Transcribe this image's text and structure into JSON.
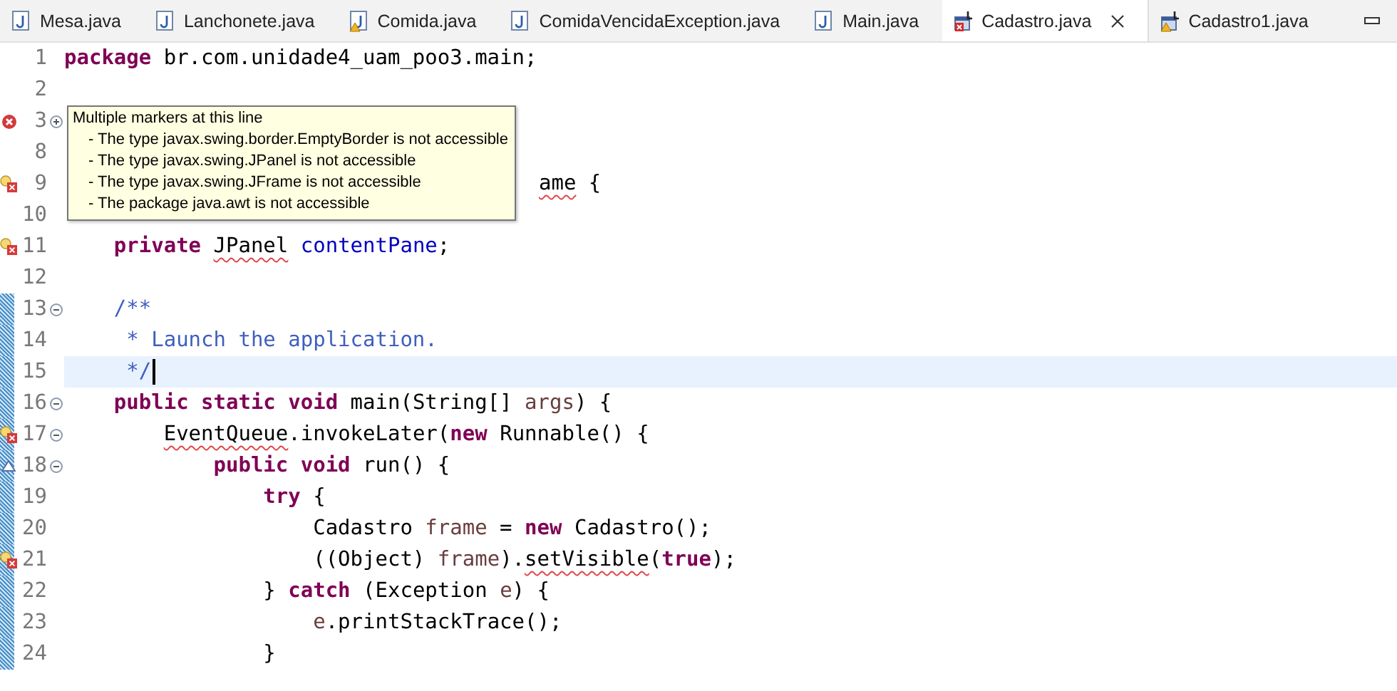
{
  "tabs": [
    {
      "label": "Mesa.java",
      "kind": "java",
      "selected": false
    },
    {
      "label": "Lanchonete.java",
      "kind": "java",
      "selected": false
    },
    {
      "label": "Comida.java",
      "kind": "javawarn",
      "selected": false
    },
    {
      "label": "ComidaVencidaException.java",
      "kind": "java",
      "selected": false
    },
    {
      "label": "Main.java",
      "kind": "java",
      "selected": false
    },
    {
      "label": "Cadastro.java",
      "kind": "formerror",
      "selected": true
    },
    {
      "label": "Cadastro1.java",
      "kind": "formwarn",
      "selected": false
    }
  ],
  "editor": {
    "lines": [
      {
        "number": "1",
        "changed": false,
        "current": false,
        "partial": false,
        "segments": [
          {
            "text": "package",
            "kind": "keyword"
          },
          {
            "text": " br.com.unidade4_uam_poo3.main;",
            "kind": "plain"
          }
        ]
      },
      {
        "number": "2",
        "changed": false,
        "current": false,
        "partial": false
      },
      {
        "number": "3",
        "marker": {
          "kind": "error"
        },
        "fold": {
          "kind": "expand"
        },
        "changed": false,
        "current": false,
        "partial": false
      },
      {
        "number": "8",
        "changed": false,
        "current": false,
        "partial": false
      },
      {
        "number": "9",
        "marker": {
          "kind": "fixerror"
        },
        "changed": false,
        "current": false,
        "partial": true,
        "segments": [
          {
            "text": "ame",
            "kind": "flagged"
          },
          {
            "text": " {",
            "kind": "plain"
          }
        ]
      },
      {
        "number": "10",
        "changed": false,
        "current": false,
        "partial": false
      },
      {
        "number": "11",
        "marker": {
          "kind": "fixerror"
        },
        "changed": false,
        "current": false,
        "partial": false,
        "segments": [
          {
            "text": "    private ",
            "kind": "keyword"
          },
          {
            "text": "JPanel",
            "kind": "flagged"
          },
          {
            "text": " contentPane",
            "kind": "field"
          },
          {
            "text": ";",
            "kind": "plain"
          }
        ]
      },
      {
        "number": "12",
        "changed": false,
        "current": false,
        "partial": false
      },
      {
        "number": "13",
        "fold": {
          "kind": "collapse"
        },
        "changed": true,
        "current": false,
        "partial": false,
        "segments": [
          {
            "text": "    /**",
            "kind": "comment"
          }
        ]
      },
      {
        "number": "14",
        "changed": true,
        "current": false,
        "partial": false,
        "segments": [
          {
            "text": "     * Launch the application.",
            "kind": "comment"
          }
        ]
      },
      {
        "number": "15",
        "changed": true,
        "current": true,
        "partial": false,
        "segments": [
          {
            "text": "     */",
            "kind": "comment"
          }
        ]
      },
      {
        "number": "16",
        "fold": {
          "kind": "collapse"
        },
        "changed": true,
        "current": false,
        "partial": false,
        "segments": [
          {
            "text": "    public static void",
            "kind": "keyword"
          },
          {
            "text": " main(String[] ",
            "kind": "plain"
          },
          {
            "text": "args",
            "kind": "local"
          },
          {
            "text": ") {",
            "kind": "plain"
          }
        ]
      },
      {
        "number": "17",
        "marker": {
          "kind": "fixerror"
        },
        "fold": {
          "kind": "collapse"
        },
        "changed": true,
        "current": false,
        "partial": false,
        "segments": [
          {
            "text": "        EventQueue",
            "kind": "flagged"
          },
          {
            "text": ".invokeLater(",
            "kind": "plain"
          },
          {
            "text": "new",
            "kind": "keyword"
          },
          {
            "text": " Runnable() {",
            "kind": "plain"
          }
        ]
      },
      {
        "number": "18",
        "marker": {
          "kind": "override"
        },
        "fold": {
          "kind": "collapse"
        },
        "changed": true,
        "current": false,
        "partial": false,
        "segments": [
          {
            "text": "            public void",
            "kind": "keyword"
          },
          {
            "text": " run() {",
            "kind": "plain"
          }
        ]
      },
      {
        "number": "19",
        "changed": true,
        "current": false,
        "partial": false,
        "segments": [
          {
            "text": "                try",
            "kind": "keyword"
          },
          {
            "text": " {",
            "kind": "plain"
          }
        ]
      },
      {
        "number": "20",
        "changed": true,
        "current": false,
        "partial": false,
        "segments": [
          {
            "text": "                    Cadastro ",
            "kind": "plain"
          },
          {
            "text": "frame",
            "kind": "local"
          },
          {
            "text": " = ",
            "kind": "plain"
          },
          {
            "text": "new",
            "kind": "keyword"
          },
          {
            "text": " Cadastro();",
            "kind": "plain"
          }
        ]
      },
      {
        "number": "21",
        "marker": {
          "kind": "fixerror"
        },
        "changed": true,
        "current": false,
        "partial": false,
        "segments": [
          {
            "text": "                    ((Object) ",
            "kind": "plain"
          },
          {
            "text": "frame",
            "kind": "local"
          },
          {
            "text": ").",
            "kind": "plain"
          },
          {
            "text": "setVisible",
            "kind": "flagged"
          },
          {
            "text": "(",
            "kind": "plain"
          },
          {
            "text": "true",
            "kind": "keyword"
          },
          {
            "text": ");",
            "kind": "plain"
          }
        ]
      },
      {
        "number": "22",
        "changed": true,
        "current": false,
        "partial": false,
        "segments": [
          {
            "text": "                } ",
            "kind": "plain"
          },
          {
            "text": "catch",
            "kind": "keyword"
          },
          {
            "text": " (Exception ",
            "kind": "plain"
          },
          {
            "text": "e",
            "kind": "local"
          },
          {
            "text": ") {",
            "kind": "plain"
          }
        ]
      },
      {
        "number": "23",
        "changed": true,
        "current": false,
        "partial": false,
        "segments": [
          {
            "text": "                    e",
            "kind": "local"
          },
          {
            "text": ".printStackTrace();",
            "kind": "plain"
          }
        ]
      },
      {
        "number": "24",
        "changed": true,
        "current": false,
        "partial": false,
        "segments": [
          {
            "text": "                }",
            "kind": "plain"
          }
        ]
      }
    ]
  },
  "tooltip": {
    "title": "Multiple markers at this line",
    "items": [
      "- The type javax.swing.border.EmptyBorder is not accessible",
      "- The type javax.swing.JPanel is not accessible",
      "- The type javax.swing.JFrame is not accessible",
      "- The package java.awt is not accessible"
    ]
  }
}
